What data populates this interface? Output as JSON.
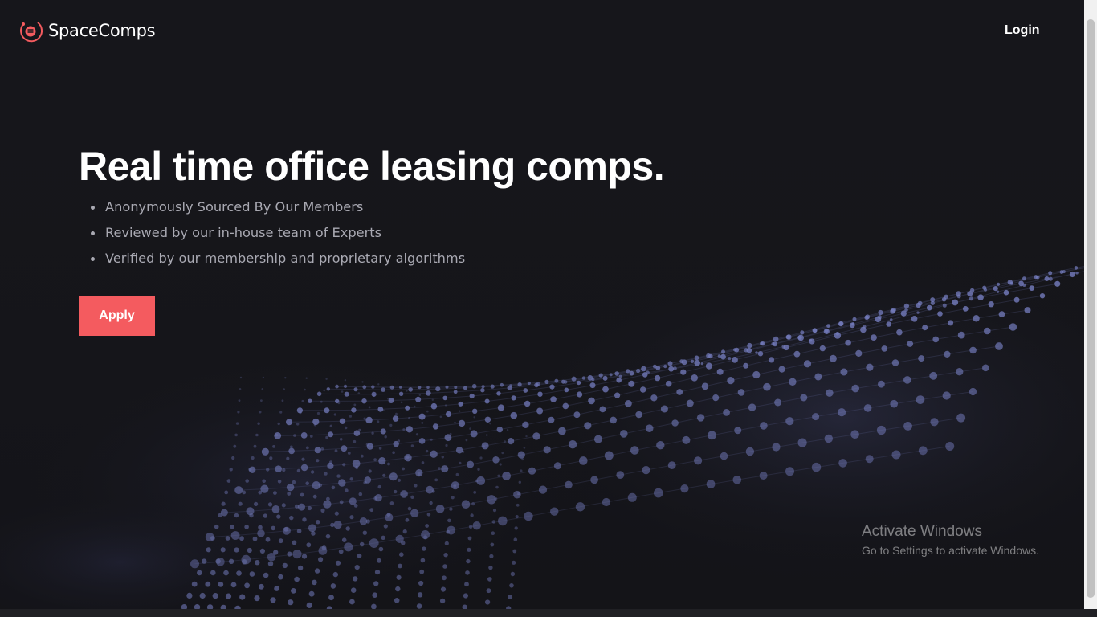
{
  "header": {
    "brand": "SpaceComps",
    "logo_icon": "spacecomps-logo-icon",
    "login_label": "Login"
  },
  "hero": {
    "title": "Real time office leasing comps.",
    "features": [
      "Anonymously Sourced By Our Members",
      "Reviewed by our in-house team of Experts",
      "Verified by our membership and proprietary algorithms"
    ],
    "apply_label": "Apply"
  },
  "windows_activation": {
    "title": "Activate Windows",
    "subtitle": "Go to Settings to activate Windows."
  },
  "colors": {
    "background": "#15151a",
    "accent": "#f45b5f",
    "text": "#ffffff",
    "muted_text": "#a9a9b2",
    "particle": "#8c96e6"
  }
}
